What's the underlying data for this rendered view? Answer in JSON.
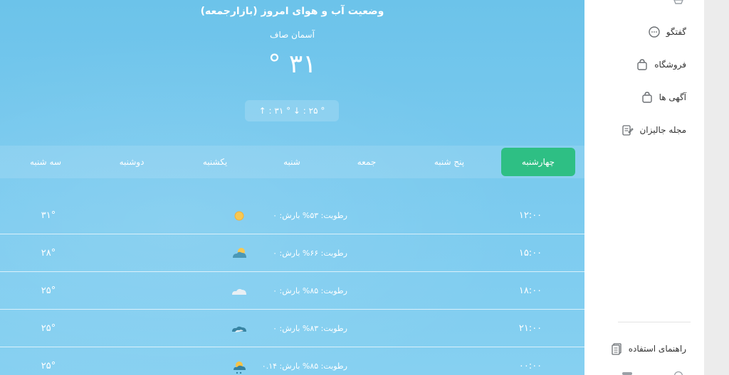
{
  "weather": {
    "title": "وضعیت آب و هوای امروز (بازارجمعه)",
    "condition": "آسمان صاف",
    "temp": "۳۱ °",
    "range": "° ۲۵ : ↓ ° ۳۱ : ↑",
    "days": [
      {
        "label": "چهارشنبه",
        "active": true
      },
      {
        "label": "پنج شنبه"
      },
      {
        "label": "جمعه"
      },
      {
        "label": "شنبه"
      },
      {
        "label": "یکشنبه"
      },
      {
        "label": "دوشنبه"
      },
      {
        "label": "سه شنبه"
      }
    ],
    "rows": [
      {
        "time": "۱۲:۰۰",
        "info": "رطوبت: ۵۳%  بارش: ۰",
        "icon": "sun-icon",
        "temp": "۳۱°"
      },
      {
        "time": "۱۵:۰۰",
        "info": "رطوبت: ۶۶%  بارش: ۰",
        "icon": "partly-cloudy-icon",
        "temp": "۲۸°"
      },
      {
        "time": "۱۸:۰۰",
        "info": "رطوبت: ۸۵%  بارش: ۰",
        "icon": "cloud-icon",
        "temp": "۲۵°"
      },
      {
        "time": "۲۱:۰۰",
        "info": "رطوبت: ۸۳%  بارش: ۰",
        "icon": "dark-cloud-icon",
        "temp": "۲۵°"
      },
      {
        "time": "۰۰:۰۰",
        "info": "رطوبت: ۸۵%  بارش: ۰.۱۴",
        "icon": "rain-sun-icon",
        "temp": "۲۵°"
      }
    ]
  },
  "sidebar": {
    "items": [
      {
        "label": "گفتگو",
        "icon": "chat-icon"
      },
      {
        "label": "فروشگاه",
        "icon": "shopping-bag-icon"
      },
      {
        "label": "آگهی ها",
        "icon": "shopping-bag-icon"
      },
      {
        "label": "مجله جالیزان",
        "icon": "notepad-icon"
      },
      {
        "label": "راهنمای استفاده",
        "icon": "document-icon"
      }
    ]
  },
  "colors": {
    "active_day": "#2ebf84",
    "sky_top": "#6cc3ea",
    "sky_bottom": "#86d0f1",
    "sidebar_text": "#333333"
  }
}
